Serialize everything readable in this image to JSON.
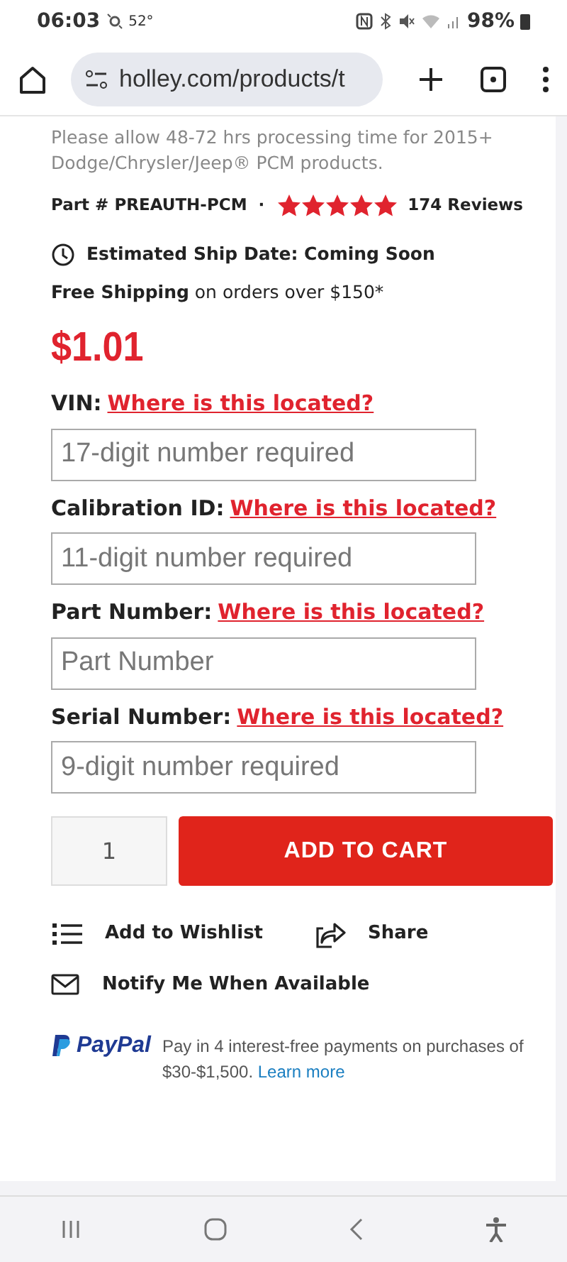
{
  "status_bar": {
    "time": "06:03",
    "temperature": "52°",
    "battery": "98%"
  },
  "browser": {
    "url": "holley.com/products/t"
  },
  "notice": "Please allow 48-72 hrs processing time for 2015+ Dodge/Chrysler/Jeep® PCM products.",
  "part": {
    "number": "Part # PREAUTH-PCM",
    "separator": "·",
    "stars": 5,
    "reviews": "174 Reviews"
  },
  "ship_date": "Estimated Ship Date: Coming Soon",
  "shipping": "**Free Shipping** on orders over $150*",
  "price": "$1.01",
  "fields": [
    {
      "label": "VIN:",
      "link": "Where is this located?",
      "placeholder": "17-digit number required"
    },
    {
      "label": "Calibration ID:",
      "link": "Where is this located?",
      "placeholder": "11-digit number required"
    },
    {
      "label": "Part Number:",
      "link": "Where is this located?",
      "placeholder": "Part Number"
    },
    {
      "label": "Serial Number:",
      "link": "Where is this located?",
      "placeholder": "9-digit number required"
    }
  ],
  "quantity": "1",
  "add_to_cart": "ADD TO CART",
  "actions": [
    {
      "kind": "wishlist",
      "label": "Add to Wishlist"
    },
    {
      "kind": "share",
      "label": "Share"
    },
    {
      "kind": "notify",
      "label": "Notify Me When Available"
    }
  ],
  "paypal": {
    "brand": "PayPal",
    "text": "Pay in 4 interest-free payments on purchases of $30-$1,500.",
    "link": "Learn more"
  }
}
